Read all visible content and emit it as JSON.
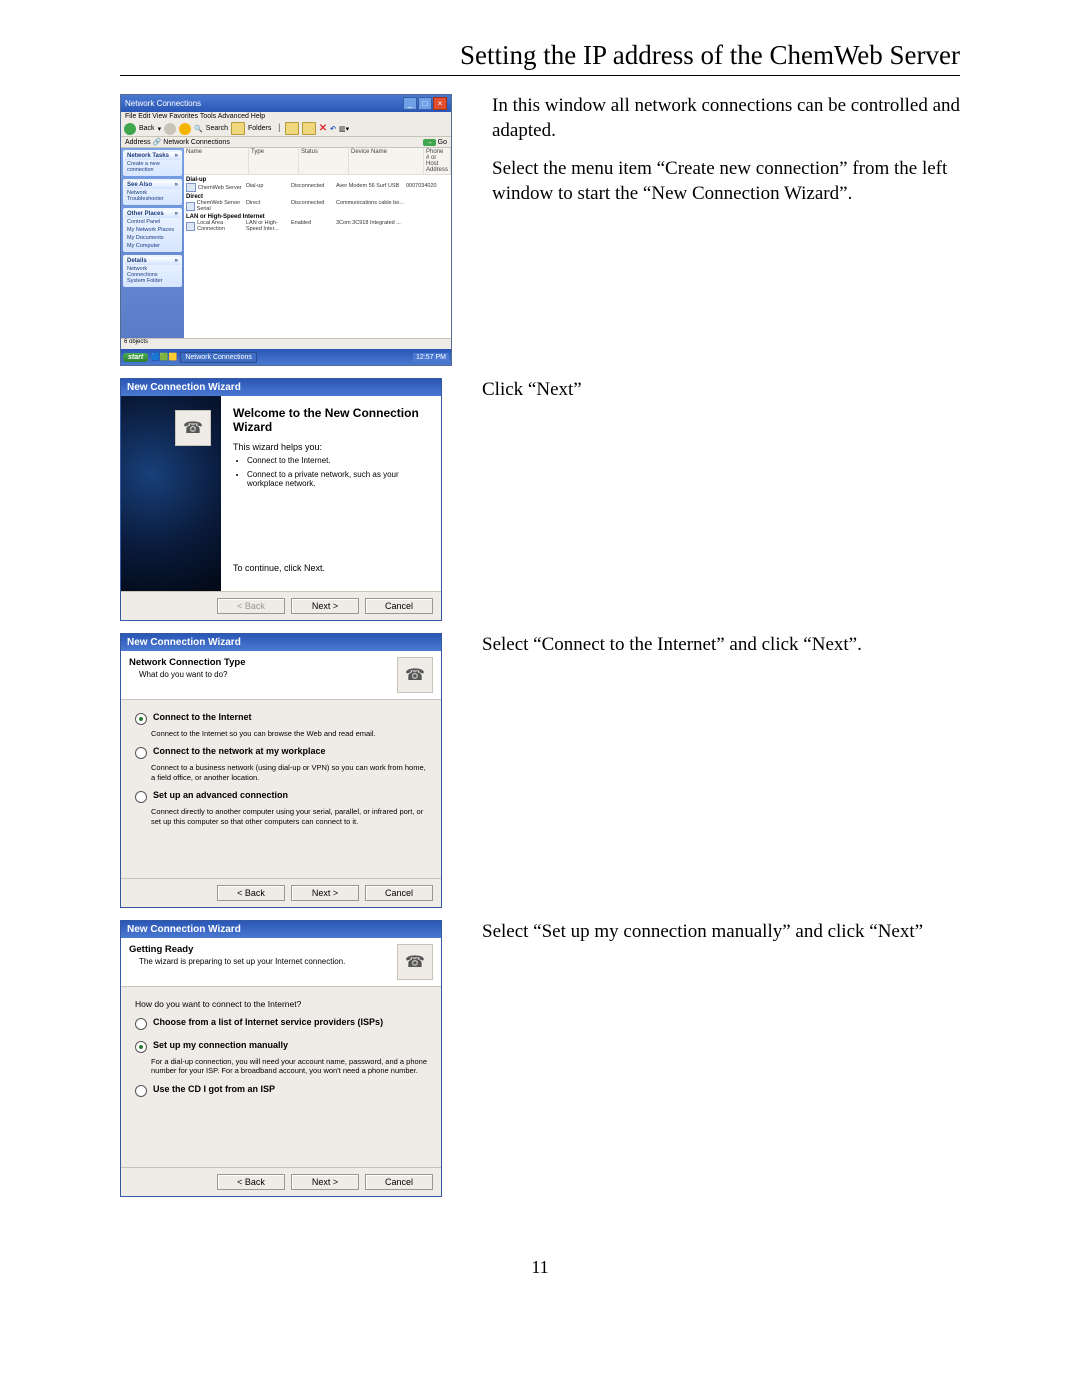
{
  "page_title": "Setting the IP address of the ChemWeb Server",
  "page_number": "11",
  "instr": {
    "s1a": "In this window all network connections can be controlled and adapted.",
    "s1b": "Select the menu item “Create new connection” from the left window to start the “New Connection Wizard”.",
    "s2": "Click “Next”",
    "s3": "Select “Connect to the Internet” and click “Next”.",
    "s4": "Select “Set up my connection manually” and click “Next”"
  },
  "shot1": {
    "title": "Network Connections",
    "menu": "File   Edit   View   Favorites   Tools   Advanced   Help",
    "toolbar": {
      "back": "Back",
      "search": "Search",
      "folders": "Folders"
    },
    "address_label": "Address",
    "address_value": "Network Connections",
    "go": "Go",
    "cols": {
      "name": "Name",
      "type": "Type",
      "status": "Status",
      "device": "Device Name",
      "phone": "Phone # or Host Address"
    },
    "groups": {
      "dialup": "Dial-up",
      "direct": "Direct",
      "lan": "LAN or High-Speed Internet"
    },
    "rows": {
      "r1": {
        "name": "ChemWeb Server",
        "type": "Dial-up",
        "status": "Disconnected",
        "device": "Aver Modem 56 Surf USB",
        "phone": "0007034020"
      },
      "r2": {
        "name": "ChemWeb Server Serial",
        "type": "Direct",
        "status": "Disconnected",
        "device": "Communications cable be..."
      },
      "r3": {
        "name": "Local Area Connection",
        "type": "LAN or High-Speed Inter...",
        "status": "Enabled",
        "device": "3Com 3C918 Integrated ..."
      }
    },
    "side": {
      "tasks_h": "Network Tasks",
      "task1": "Create a new connection",
      "see_h": "See Also",
      "see1": "Network Troubleshooter",
      "other_h": "Other Places",
      "o1": "Control Panel",
      "o2": "My Network Places",
      "o3": "My Documents",
      "o4": "My Computer",
      "details_h": "Details",
      "details_t": "Network Connections\nSystem Folder"
    },
    "status_bar": "6 objects",
    "taskbar": {
      "start": "start",
      "app": "Network Connections",
      "time": "12:57 PM"
    }
  },
  "wiz_title": "New Connection Wizard",
  "w2": {
    "heading": "Welcome to the New Connection Wizard",
    "helps": "This wizard helps you:",
    "li1": "Connect to the Internet.",
    "li2": "Connect to a private network, such as your workplace network.",
    "cont": "To continue, click Next."
  },
  "w3": {
    "head": "Network Connection Type",
    "sub": "What do you want to do?",
    "o1": "Connect to the Internet",
    "o1d": "Connect to the Internet so you can browse the Web and read email.",
    "o2": "Connect to the network at my workplace",
    "o2d": "Connect to a business network (using dial-up or VPN) so you can work from home, a field office, or another location.",
    "o3": "Set up an advanced connection",
    "o3d": "Connect directly to another computer using your serial, parallel, or infrared port, or set up this computer so that other computers can connect to it."
  },
  "w4": {
    "head": "Getting Ready",
    "sub": "The wizard is preparing to set up your Internet connection.",
    "q": "How do you want to connect to the Internet?",
    "o1": "Choose from a list of Internet service providers (ISPs)",
    "o2": "Set up my connection manually",
    "o2d": "For a dial-up connection, you will need your account name, password, and a phone number for your ISP. For a broadband account, you won't need a phone number.",
    "o3": "Use the CD I got from an ISP"
  },
  "btns": {
    "back": "< Back",
    "next": "Next >",
    "cancel": "Cancel"
  }
}
